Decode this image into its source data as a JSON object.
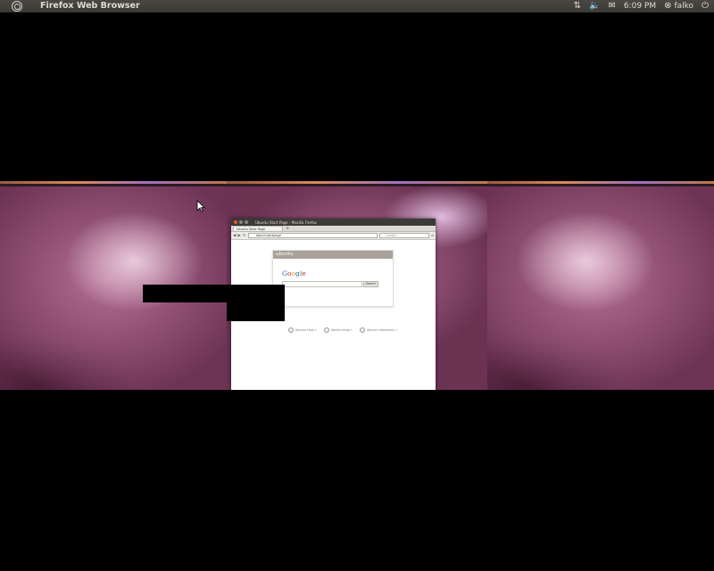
{
  "panel": {
    "app_title": "Firefox Web Browser",
    "clock": "6:09 PM",
    "user": "falko",
    "icons": [
      "ubuntu-logo-icon",
      "network-icon",
      "volume-muted-icon",
      "mail-icon",
      "user-icon",
      "power-icon"
    ]
  },
  "firefox": {
    "window_title": "Ubuntu Start Page - Mozilla Firefox",
    "tab_label": "Ubuntu Start Page",
    "url": "about:startpage",
    "search_engine": "Google",
    "start_header": "ubuntu",
    "search_button": "Search",
    "links": [
      "Ubuntu Help »",
      "Ubuntu shop »",
      "Ubuntu community »"
    ]
  },
  "colors": {
    "panel_bg": "#3c3b37",
    "wallpaper": "#6d3254",
    "accent_orange": "#e2582d"
  }
}
